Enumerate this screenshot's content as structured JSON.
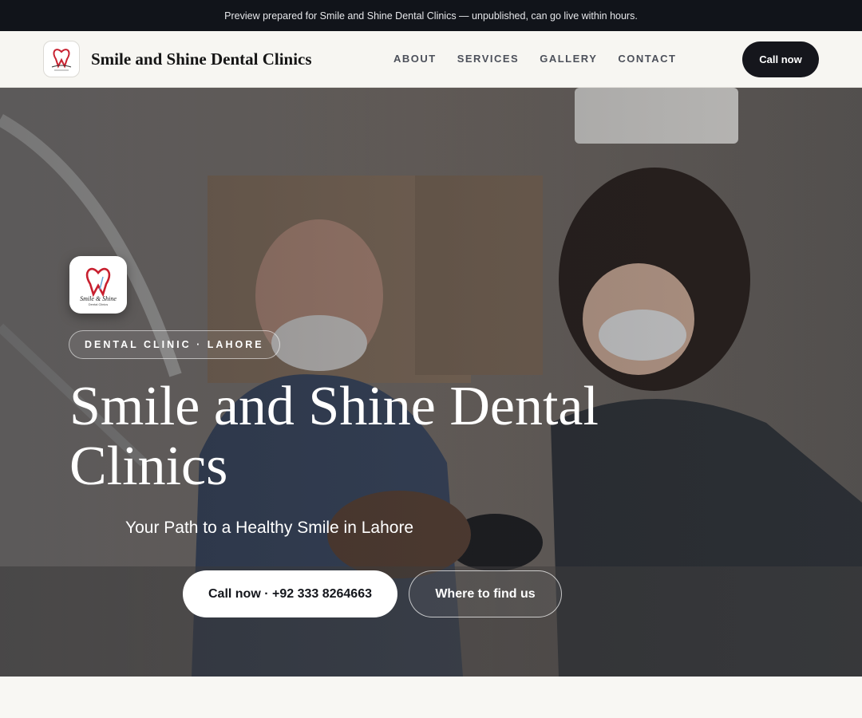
{
  "preview_bar": {
    "text": "Preview prepared for Smile and Shine Dental Clinics — unpublished, can go live within hours."
  },
  "header": {
    "brand_name": "Smile and Shine Dental Clinics",
    "logo_icon": "tooth-heart-logo",
    "nav": [
      {
        "label": "ABOUT"
      },
      {
        "label": "SERVICES"
      },
      {
        "label": "GALLERY"
      },
      {
        "label": "CONTACT"
      }
    ],
    "call_button": "Call now"
  },
  "hero": {
    "background_icon": "dentists-treating-patient-photo",
    "logo_icon": "tooth-heart-logo",
    "badge": "DENTAL CLINIC · LAHORE",
    "title": "Smile and Shine Dental Clinics",
    "subtitle": "Your Path to a Healthy Smile in Lahore",
    "primary_button": "Call now · +92 333 8264663",
    "secondary_button": "Where to find us"
  },
  "colors": {
    "preview_bar_bg": "#11141a",
    "header_bg": "#f7f6f2",
    "accent_dark": "#15161c",
    "logo_red": "#c8202f"
  }
}
